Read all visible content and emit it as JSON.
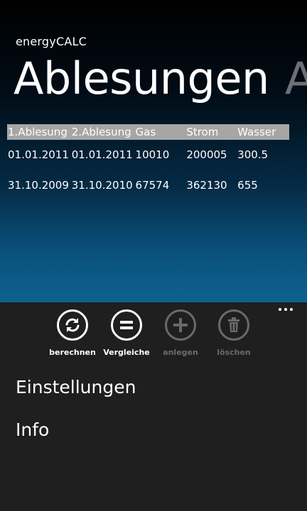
{
  "app": {
    "title": "energyCALC"
  },
  "pivot": {
    "current": "Ablesungen",
    "next_peek": "Ab"
  },
  "table": {
    "columns": [
      "1.Ablesung",
      "2.Ablesung",
      "Gas",
      "Strom",
      "Wasser"
    ],
    "rows": [
      [
        "01.01.2011",
        "01.01.2011",
        "10010",
        "200005",
        "300.5"
      ],
      [
        "31.10.2009",
        "31.10.2010",
        "67574",
        "362130",
        "655"
      ]
    ]
  },
  "appbar": {
    "buttons": [
      {
        "label": "berechnen",
        "icon": "refresh-icon",
        "enabled": true
      },
      {
        "label": "Vergleiche",
        "icon": "equals-icon",
        "enabled": true
      },
      {
        "label": "anlegen",
        "icon": "add-icon",
        "enabled": false
      },
      {
        "label": "löschen",
        "icon": "trash-icon",
        "enabled": false
      }
    ],
    "menu": [
      "Einstellungen",
      "Info"
    ]
  },
  "colors": {
    "header_row_bg": "#a6a6a6",
    "appbar_bg": "#1f1f1f",
    "disabled": "#6a6a6a",
    "gradient_bottom": "#0d6290"
  }
}
